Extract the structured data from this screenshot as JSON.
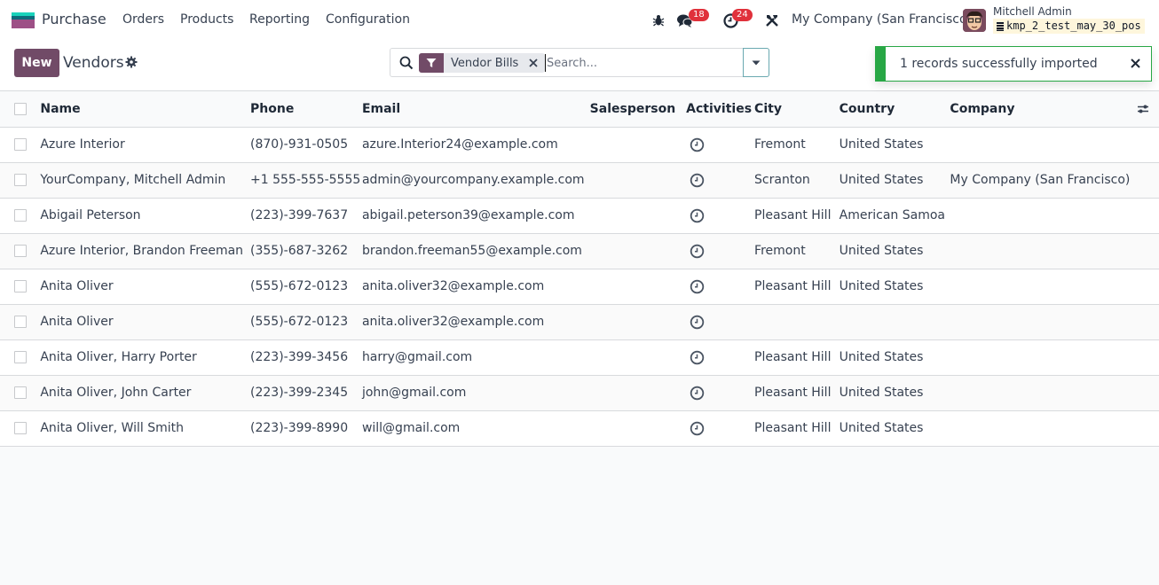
{
  "navbar": {
    "app_name": "Purchase",
    "menu": [
      "Orders",
      "Products",
      "Reporting",
      "Configuration"
    ],
    "icons": [
      "bug-icon",
      "chat-icon",
      "clock-icon",
      "tools-icon"
    ],
    "messages_count": "18",
    "activities_count": "24",
    "company": "My Company (San Francisco)",
    "user_name": "Mitchell Admin",
    "database": "kmp_2_test_may_30_pos"
  },
  "control_panel": {
    "new_label": "New",
    "title": "Vendors",
    "search": {
      "facet_label": "Vendor Bills",
      "placeholder": "Search..."
    }
  },
  "notification": {
    "message": "1 records successfully imported"
  },
  "colors": {
    "brand": "#714b67",
    "success": "#28a745",
    "badge": "#e0313b"
  },
  "table": {
    "columns": [
      "Name",
      "Phone",
      "Email",
      "Salesperson",
      "Activities",
      "City",
      "Country",
      "Company"
    ],
    "rows": [
      {
        "name": "Azure Interior",
        "phone": "(870)-931-0505",
        "email": "azure.Interior24@example.com",
        "salesperson": "",
        "city": "Fremont",
        "country": "United States",
        "company": ""
      },
      {
        "name": "YourCompany, Mitchell Admin",
        "phone": "+1 555-555-5555",
        "email": "admin@yourcompany.example.com",
        "salesperson": "",
        "city": "Scranton",
        "country": "United States",
        "company": "My Company (San Francisco)"
      },
      {
        "name": "Abigail Peterson",
        "phone": "(223)-399-7637",
        "email": "abigail.peterson39@example.com",
        "salesperson": "",
        "city": "Pleasant Hill",
        "country": "American Samoa",
        "company": ""
      },
      {
        "name": "Azure Interior, Brandon Freeman",
        "phone": "(355)-687-3262",
        "email": "brandon.freeman55@example.com",
        "salesperson": "",
        "city": "Fremont",
        "country": "United States",
        "company": ""
      },
      {
        "name": "Anita Oliver",
        "phone": "(555)-672-0123",
        "email": "anita.oliver32@example.com",
        "salesperson": "",
        "city": "Pleasant Hill",
        "country": "United States",
        "company": ""
      },
      {
        "name": "Anita Oliver",
        "phone": "(555)-672-0123",
        "email": "anita.oliver32@example.com",
        "salesperson": "",
        "city": "",
        "country": "",
        "company": ""
      },
      {
        "name": "Anita Oliver, Harry Porter",
        "phone": "(223)-399-3456",
        "email": "harry@gmail.com",
        "salesperson": "",
        "city": "Pleasant Hill",
        "country": "United States",
        "company": ""
      },
      {
        "name": "Anita Oliver, John Carter",
        "phone": "(223)-399-2345",
        "email": "john@gmail.com",
        "salesperson": "",
        "city": "Pleasant Hill",
        "country": "United States",
        "company": ""
      },
      {
        "name": "Anita Oliver, Will Smith",
        "phone": "(223)-399-8990",
        "email": "will@gmail.com",
        "salesperson": "",
        "city": "Pleasant Hill",
        "country": "United States",
        "company": ""
      }
    ]
  }
}
